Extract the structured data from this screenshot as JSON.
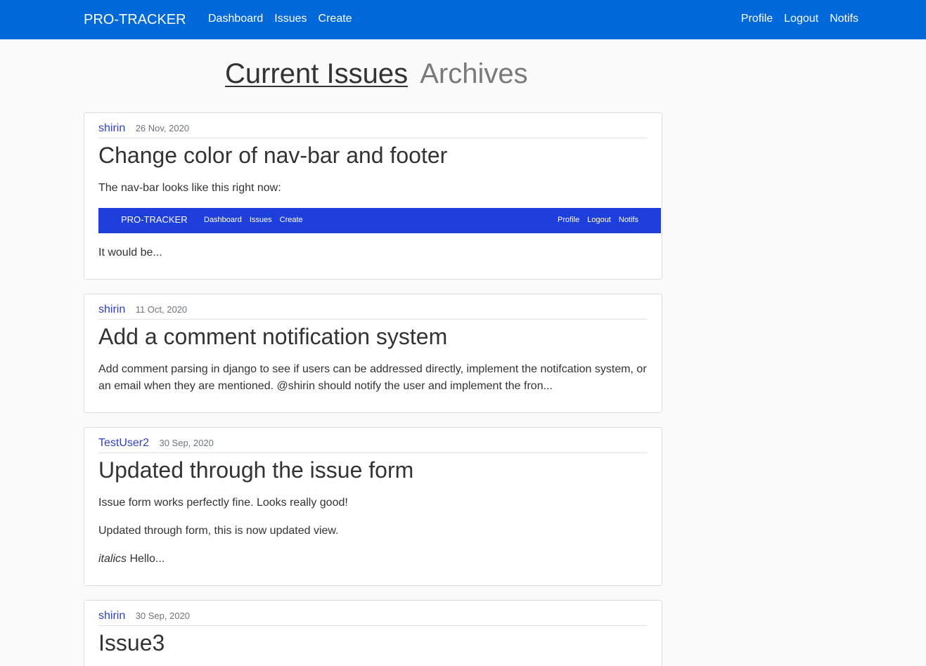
{
  "navbar": {
    "brand": "PRO-TRACKER",
    "left_links": [
      "Dashboard",
      "Issues",
      "Create"
    ],
    "right_links": [
      "Profile",
      "Logout",
      "Notifs"
    ],
    "color": "#0069d9"
  },
  "heading": {
    "current": "Current Issues",
    "archives": "Archives"
  },
  "issues": [
    {
      "author": "shirin",
      "date": "26 Nov, 2020",
      "title": "Change color of nav-bar and footer",
      "paragraphs": [
        "The nav-bar looks like this right now:",
        "It would be..."
      ],
      "embed": {
        "brand": "PRO-TRACKER",
        "left_links": [
          "Dashboard",
          "Issues",
          "Create"
        ],
        "right_links": [
          "Profile",
          "Logout",
          "Notifs"
        ],
        "color": "#1f3fdc"
      }
    },
    {
      "author": "shirin",
      "date": "11 Oct, 2020",
      "title": "Add a comment notification system",
      "paragraphs": [
        "Add comment parsing in django to see if users can be addressed directly, implement the notifcation system, or an email when they are mentioned. @shirin should notify the user and implement the fron..."
      ]
    },
    {
      "author": "TestUser2",
      "date": "30 Sep, 2020",
      "title": "Updated through the issue form",
      "paragraphs": [
        "Issue form works perfectly fine. Looks really good!",
        "Updated through form, this is now updated view."
      ],
      "italic_word": "italics",
      "italic_rest": " Hello..."
    },
    {
      "author": "shirin",
      "date": "30 Sep, 2020",
      "title": "Issue3"
    }
  ]
}
